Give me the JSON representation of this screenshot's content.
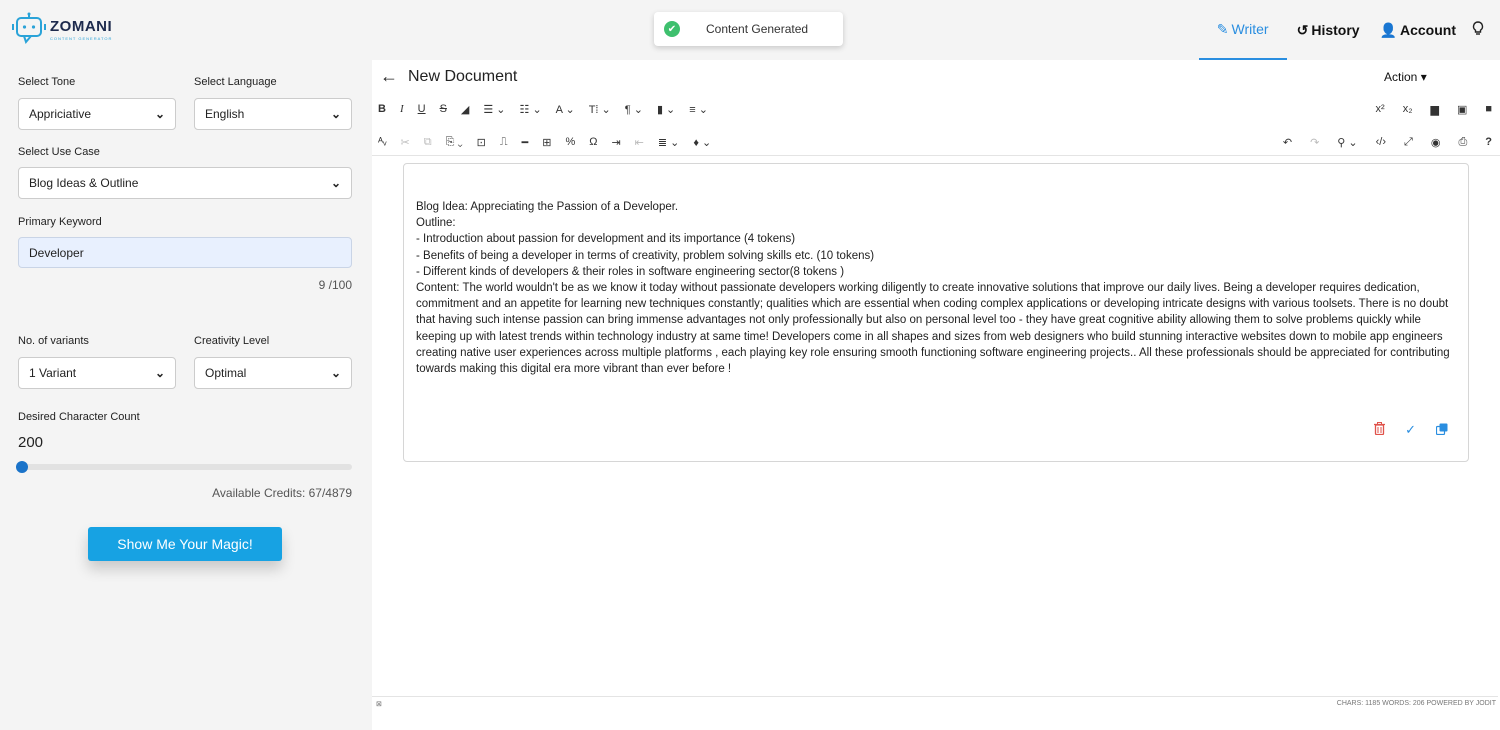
{
  "brand": {
    "name": "ZOMANI",
    "tagline": "CONTENT GENERATOR",
    "logo_icon": "robot-chat-icon"
  },
  "toast": {
    "message": "Content Generated",
    "icon": "check-circle-icon"
  },
  "nav": {
    "writer": "Writer",
    "history": "History",
    "account": "Account",
    "help_icon": "lightbulb-icon"
  },
  "sidebar": {
    "tone_label": "Select Tone",
    "tone_value": "Appriciative",
    "language_label": "Select Language",
    "language_value": "English",
    "use_case_label": "Select Use Case",
    "use_case_value": "Blog Ideas & Outline",
    "keyword_label": "Primary Keyword",
    "keyword_value": "Developer",
    "keyword_counter": "9 /100",
    "variants_label": "No. of variants",
    "variants_value": "1 Variant",
    "creativity_label": "Creativity Level",
    "creativity_value": "Optimal",
    "char_count_label": "Desired Character Count",
    "char_count_value": "200",
    "credits": "Available Credits: 67/4879",
    "submit_label": "Show Me Your Magic!"
  },
  "editor": {
    "title": "New Document",
    "action_label": "Action",
    "content": [
      "Blog Idea: Appreciating the Passion of a Developer.",
      "Outline:",
      "- Introduction about passion for development and its importance (4 tokens)",
      "- Benefits of being a developer in terms of creativity, problem solving skills etc. (10 tokens)",
      "- Different kinds of developers & their roles in software engineering sector(8 tokens )",
      "Content: The world wouldn't be as we know it today without passionate developers working diligently to create innovative solutions that improve our daily lives. Being a developer requires dedication, commitment and an appetite for learning new techniques constantly; qualities which are essential when coding complex applications or developing intricate designs with various toolsets. There is no doubt that having such intense passion can bring immense advantages not only professionally but also on personal level too - they have great cognitive ability allowing them to solve problems quickly while keeping up with latest trends within technology industry at same time! Developers come in all shapes and sizes from web designers who build stunning interactive websites down to mobile app engineers creating native user experiences across multiple platforms , each playing key role ensuring smooth functioning software engineering projects.. All these professionals should be appreciated for contributing towards making this digital era more vibrant than ever before !"
    ],
    "status": "CHARS: 1185  WORDS: 206  POWERED BY JODIT"
  },
  "colors": {
    "accent": "#2a8ee0",
    "button": "#17a2e3",
    "success": "#3ec06e",
    "danger": "#e0524a"
  }
}
